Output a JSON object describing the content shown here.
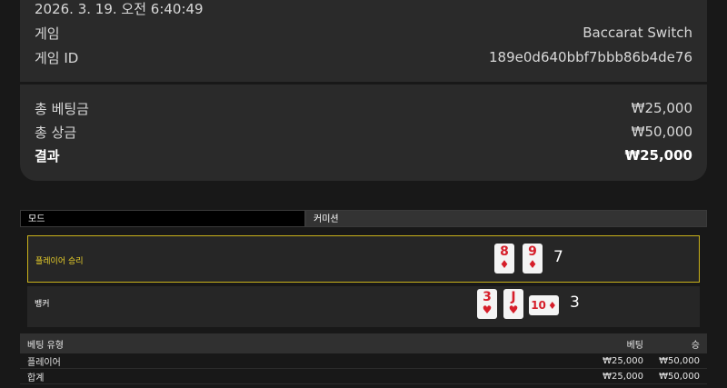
{
  "summary": {
    "timestamp": "2026. 3. 19. 오전 6:40:49",
    "game_label": "게임",
    "game_value": "Baccarat Switch",
    "game_id_label": "게임 ID",
    "game_id_value": "189e0d640bbf7bbb86b4de76"
  },
  "totals": {
    "total_bet_label": "총 베팅금",
    "total_bet_value": "₩25,000",
    "total_win_label": "총 상금",
    "total_win_value": "₩50,000",
    "result_label": "결과",
    "result_value": "₩25,000"
  },
  "tabs": [
    {
      "label": "모드"
    },
    {
      "label": "커미션"
    }
  ],
  "hands": {
    "player": {
      "name": "플레이어 승리",
      "score": "7",
      "cards": [
        {
          "rank": "8",
          "suit": "♦"
        },
        {
          "rank": "9",
          "suit": "♦"
        }
      ]
    },
    "banker": {
      "name": "뱅커",
      "score": "3",
      "cards": [
        {
          "rank": "3",
          "suit": "♥"
        },
        {
          "rank": "J",
          "suit": "♥"
        },
        {
          "rank": "10",
          "suit": "♦"
        }
      ]
    }
  },
  "bets_table": {
    "headers": {
      "type": "베팅 유형",
      "bet": "베팅",
      "win": "승"
    },
    "rows": [
      {
        "type": "플레이어",
        "bet": "₩25,000",
        "win": "₩50,000"
      },
      {
        "type": "합계",
        "bet": "₩25,000",
        "win": "₩50,000"
      }
    ]
  },
  "colors": {
    "accent_gold": "#c9b21b",
    "card_red": "#d61e2a",
    "panel_bg": "#2a2a2a"
  }
}
